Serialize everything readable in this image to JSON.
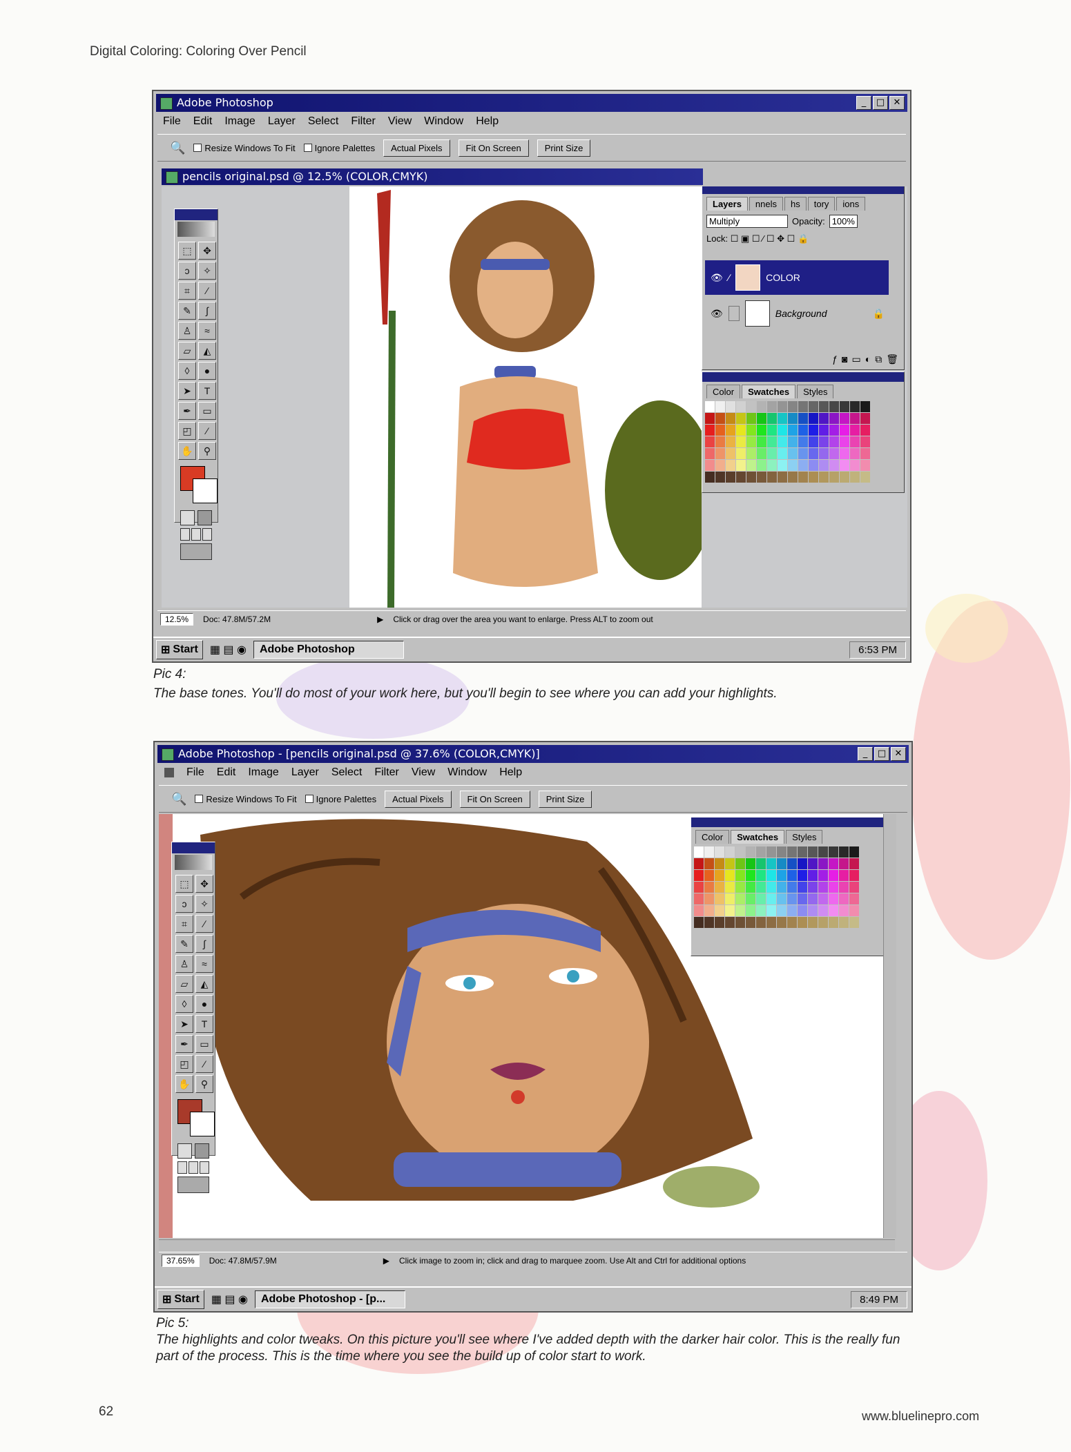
{
  "page": {
    "header": "Digital Coloring: Coloring Over Pencil",
    "page_number": "62",
    "url": "www.bluelinepro.com"
  },
  "shot1": {
    "title": "Adobe Photoshop",
    "menu": [
      "File",
      "Edit",
      "Image",
      "Layer",
      "Select",
      "Filter",
      "View",
      "Window",
      "Help"
    ],
    "options": {
      "resize": "Resize Windows To Fit",
      "ignore": "Ignore Palettes",
      "actual": "Actual Pixels",
      "fit": "Fit On Screen",
      "print": "Print Size"
    },
    "doc_title": "pencils original.psd @ 12.5% (COLOR,CMYK)",
    "layers_palette": {
      "tabs": [
        "Layers",
        "nnels",
        "hs",
        "tory",
        "ions"
      ],
      "blend_mode": "Multiply",
      "opacity_label": "Opacity:",
      "opacity_value": "100%",
      "lock_label": "Lock:",
      "layers": [
        {
          "name": "COLOR"
        },
        {
          "name": "Background"
        }
      ]
    },
    "swatch_tabs": [
      "Color",
      "Swatches",
      "Styles"
    ],
    "status": {
      "zoom": "12.5%",
      "doc": "Doc: 47.8M/57.2M",
      "hint": "Click or drag over the area you want to enlarge. Press ALT to zoom out"
    },
    "taskbar": {
      "start": "Start",
      "task": "Adobe Photoshop",
      "time": "6:53 PM"
    }
  },
  "caption1": {
    "label": "Pic 4:",
    "text": "The base tones.  You'll do most of your work here, but you'll begin to see where you can add your highlights."
  },
  "shot2": {
    "title": "Adobe Photoshop - [pencils original.psd @ 37.6% (COLOR,CMYK)]",
    "menu": [
      "File",
      "Edit",
      "Image",
      "Layer",
      "Select",
      "Filter",
      "View",
      "Window",
      "Help"
    ],
    "options": {
      "resize": "Resize Windows To Fit",
      "ignore": "Ignore Palettes",
      "actual": "Actual Pixels",
      "fit": "Fit On Screen",
      "print": "Print Size"
    },
    "swatch_tabs": [
      "Color",
      "Swatches",
      "Styles"
    ],
    "status": {
      "zoom": "37.65%",
      "doc": "Doc: 47.8M/57.9M",
      "hint": "Click image to zoom in; click and drag to marquee zoom.  Use Alt and Ctrl for additional options"
    },
    "taskbar": {
      "start": "Start",
      "task": "Adobe Photoshop - [p...",
      "time": "8:49 PM"
    }
  },
  "caption2": {
    "label": "Pic 5:",
    "text": "The highlights and color tweaks.  On this picture you'll see where I've added depth with the darker hair color.  This is the really fun part of the process.  This is the time where you see the build up of color start to work."
  },
  "colors": {
    "titlebar": "#10136f",
    "window": "#c0c0c0",
    "foreground_swatch": "#d83b24"
  }
}
